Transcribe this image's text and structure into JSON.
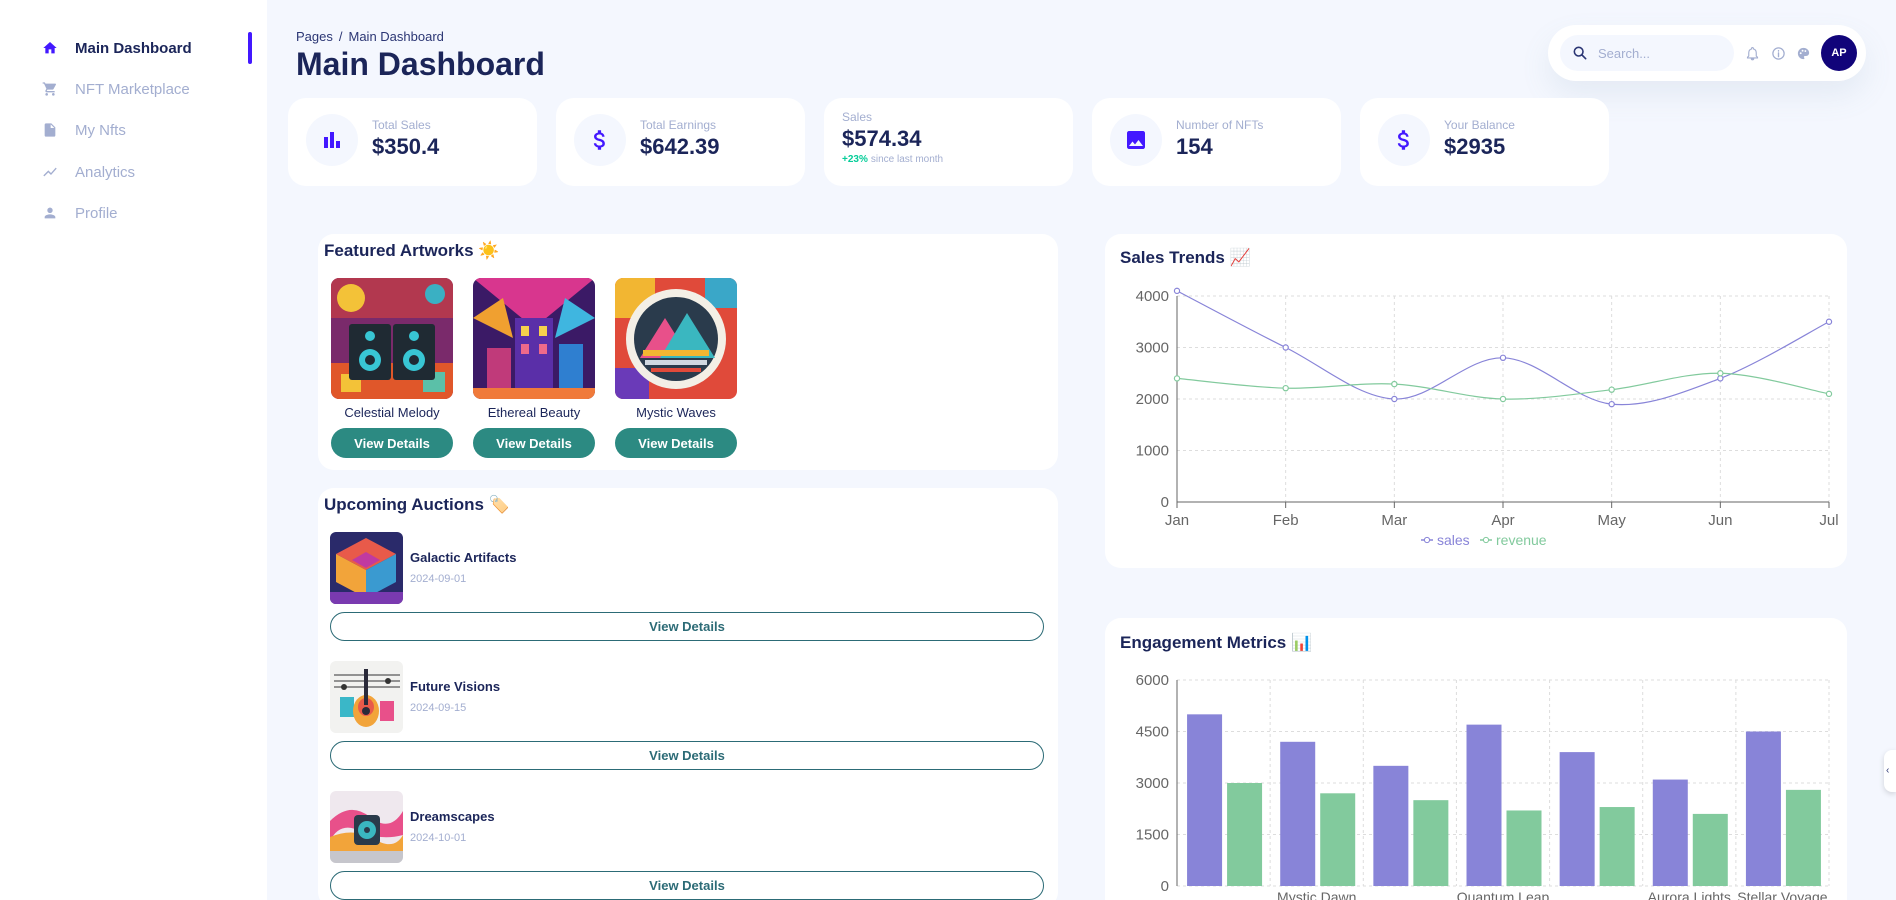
{
  "colors": {
    "accent": "#4318ff",
    "sales": "#8884d8",
    "revenue": "#82ca9d",
    "button": "#2c8a82"
  },
  "sidebar": {
    "items": [
      {
        "label": "Main Dashboard",
        "icon": "home-icon",
        "active": true
      },
      {
        "label": "NFT Marketplace",
        "icon": "cart-icon",
        "active": false
      },
      {
        "label": "My Nfts",
        "icon": "document-icon",
        "active": false
      },
      {
        "label": "Analytics",
        "icon": "trend-icon",
        "active": false
      },
      {
        "label": "Profile",
        "icon": "person-icon",
        "active": false
      }
    ]
  },
  "header": {
    "breadcrumb_root": "Pages",
    "breadcrumb_separator": "/",
    "breadcrumb_current": "Main Dashboard",
    "title": "Main Dashboard"
  },
  "topbar": {
    "search_placeholder": "Search...",
    "avatar_initials": "AP"
  },
  "stats": [
    {
      "label": "Total Sales",
      "value": "$350.4",
      "icon": "bar-chart-icon"
    },
    {
      "label": "Total Earnings",
      "value": "$642.39",
      "icon": "dollar-icon"
    },
    {
      "label": "Sales",
      "value": "$574.34",
      "change": "+23%",
      "change_text": "since last month"
    },
    {
      "label": "Number of NFTs",
      "value": "154",
      "icon": "image-icon"
    },
    {
      "label": "Your Balance",
      "value": "$2935",
      "icon": "dollar-icon"
    }
  ],
  "featured": {
    "title": "Featured Artworks ☀️",
    "button_label": "View Details",
    "items": [
      {
        "name": "Celestial Melody"
      },
      {
        "name": "Ethereal Beauty"
      },
      {
        "name": "Mystic Waves"
      }
    ]
  },
  "auctions": {
    "title": "Upcoming Auctions 🏷️",
    "button_label": "View Details",
    "items": [
      {
        "name": "Galactic Artifacts",
        "date": "2024-09-01"
      },
      {
        "name": "Future Visions",
        "date": "2024-09-15"
      },
      {
        "name": "Dreamscapes",
        "date": "2024-10-01"
      }
    ]
  },
  "sales_trends": {
    "title": "Sales Trends 📈"
  },
  "engagement": {
    "title": "Engagement Metrics 📊"
  },
  "chart_data": [
    {
      "type": "line",
      "title": "Sales Trends 📈",
      "categories": [
        "Jan",
        "Feb",
        "Mar",
        "Apr",
        "May",
        "Jun",
        "Jul"
      ],
      "ylim": [
        0,
        4000
      ],
      "yticks": [
        0,
        1000,
        2000,
        3000,
        4000
      ],
      "grid": true,
      "legend": "bottom",
      "series": [
        {
          "name": "sales",
          "values": [
            4100,
            3000,
            2000,
            2800,
            1900,
            2400,
            3500
          ],
          "color": "#8884d8"
        },
        {
          "name": "revenue",
          "values": [
            2400,
            2210,
            2290,
            2000,
            2181,
            2500,
            2100
          ],
          "color": "#82ca9d"
        }
      ]
    },
    {
      "type": "bar",
      "title": "Engagement Metrics 📊",
      "categories": [
        "",
        "Mystic Dawn",
        "",
        "Quantum Leap",
        "",
        "Aurora Lights",
        "Stellar Voyage"
      ],
      "ylim": [
        0,
        6000
      ],
      "yticks": [
        0,
        1500,
        3000,
        4500,
        6000
      ],
      "grid": true,
      "series": [
        {
          "values": [
            5000,
            4200,
            3500,
            4700,
            3900,
            3100,
            4500
          ],
          "color": "#8884d8"
        },
        {
          "values": [
            3000,
            2700,
            2500,
            2200,
            2300,
            2100,
            2800
          ],
          "color": "#82ca9d"
        }
      ]
    }
  ]
}
